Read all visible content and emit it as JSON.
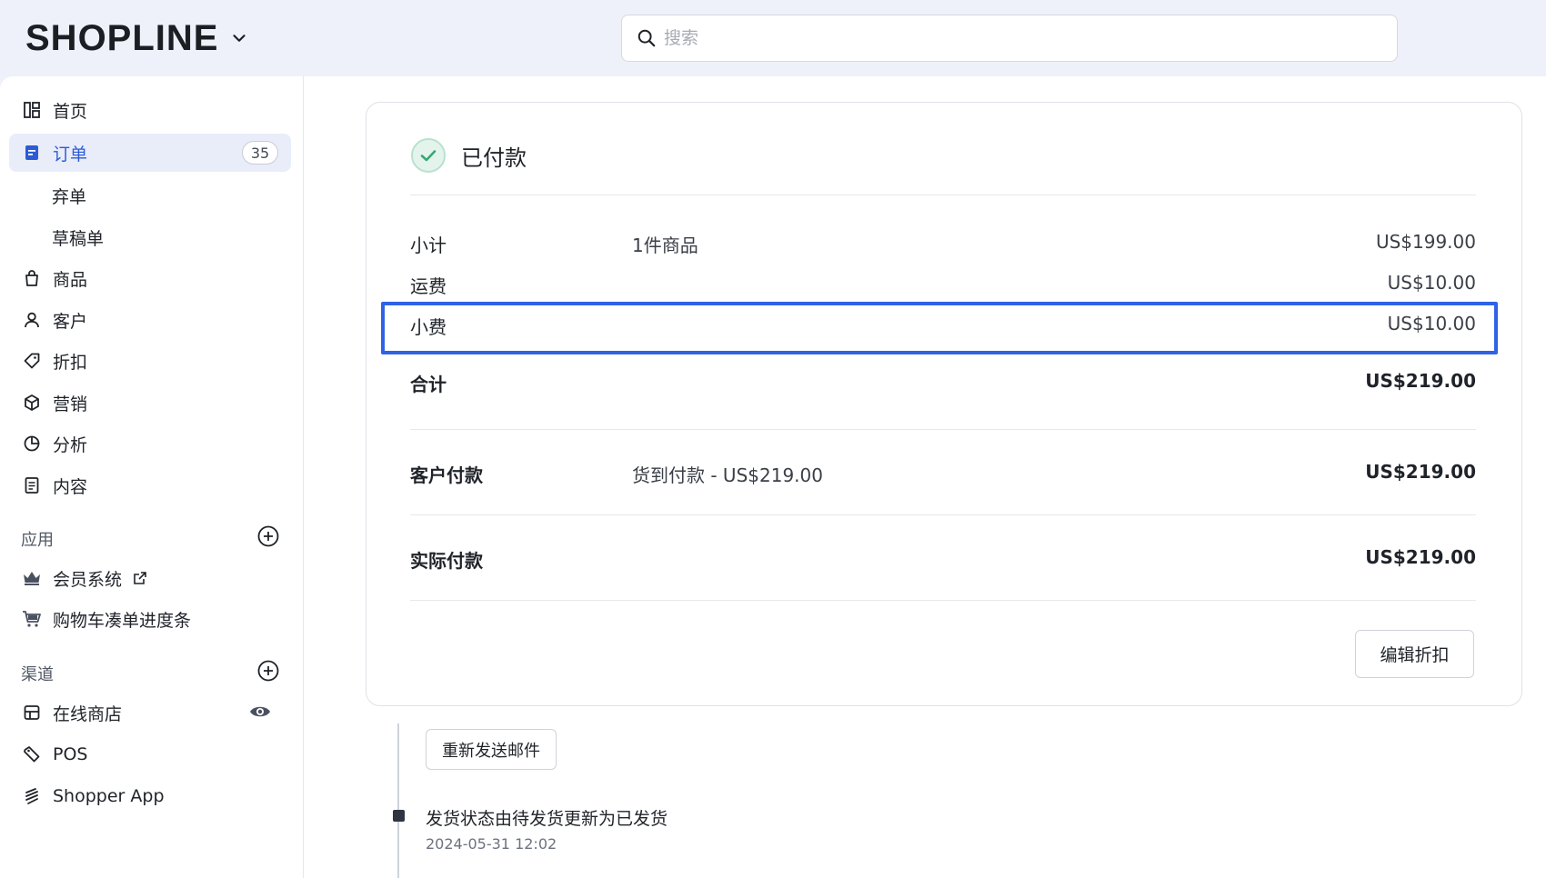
{
  "header": {
    "logo": "SHOPLINE",
    "search_placeholder": "搜索"
  },
  "sidebar": {
    "items": [
      {
        "label": "首页"
      },
      {
        "label": "订单",
        "badge": "35"
      },
      {
        "label": "弃单"
      },
      {
        "label": "草稿单"
      },
      {
        "label": "商品"
      },
      {
        "label": "客户"
      },
      {
        "label": "折扣"
      },
      {
        "label": "营销"
      },
      {
        "label": "分析"
      },
      {
        "label": "内容"
      }
    ],
    "apps_label": "应用",
    "apps": [
      {
        "label": "会员系统"
      },
      {
        "label": "购物车凑单进度条"
      }
    ],
    "channels_label": "渠道",
    "channels": [
      {
        "label": "在线商店"
      },
      {
        "label": "POS"
      },
      {
        "label": "Shopper App"
      }
    ]
  },
  "payment": {
    "status": "已付款",
    "subtotal": {
      "label": "小计",
      "detail": "1件商品",
      "amount": "US$199.00"
    },
    "shipping": {
      "label": "运费",
      "amount": "US$10.00"
    },
    "tip": {
      "label": "小费",
      "amount": "US$10.00"
    },
    "total": {
      "label": "合计",
      "amount": "US$219.00"
    },
    "customer_paid": {
      "label": "客户付款",
      "detail": "货到付款 - US$219.00",
      "amount": "US$219.00"
    },
    "actual_paid": {
      "label": "实际付款",
      "amount": "US$219.00"
    },
    "edit_button": "编辑折扣"
  },
  "timeline": {
    "resend_button": "重新发送邮件",
    "event_title": "发货状态由待发货更新为已发货",
    "event_time": "2024-05-31 12:02"
  },
  "colors": {
    "accent": "#2d5bd6",
    "highlight": "#2e63e6",
    "success": "#3aa776"
  }
}
